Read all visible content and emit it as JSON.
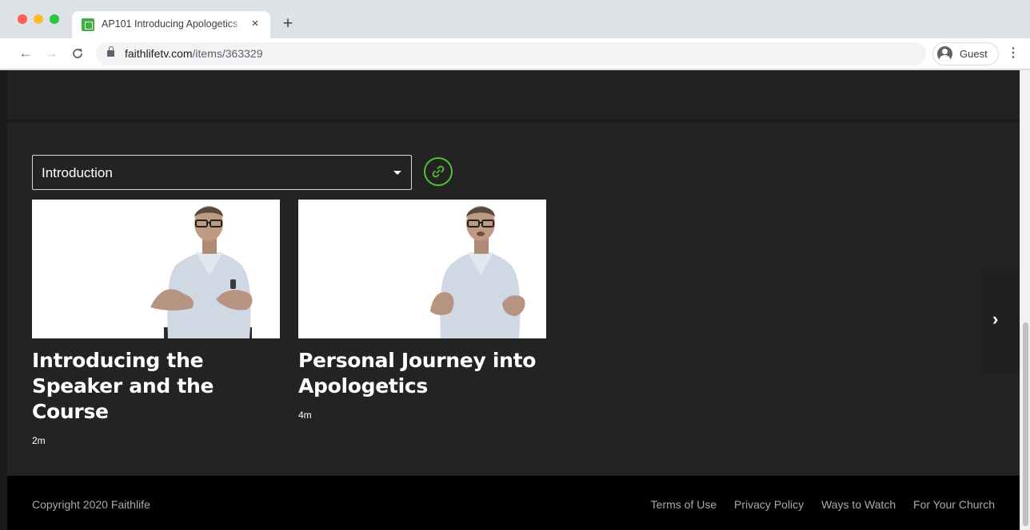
{
  "browser": {
    "tab_title": "AP101 Introducing Apologetics",
    "tab_close": "×",
    "new_tab": "+",
    "url_host": "faithlifetv.com",
    "url_path": "/items/363329",
    "profile_label": "Guest",
    "back_icon": "←",
    "forward_icon": "→",
    "reload_icon": "C",
    "menu_icon": "⋮"
  },
  "page": {
    "section_select": {
      "value": "Introduction"
    },
    "next_arrow": "›",
    "episodes": [
      {
        "title": "Introducing the Speaker and the Course",
        "duration": "2m"
      },
      {
        "title": "Personal Journey into Apologetics",
        "duration": "4m"
      }
    ]
  },
  "footer": {
    "copyright": "Copyright 2020 Faithlife",
    "links": [
      "Terms of Use",
      "Privacy Policy",
      "Ways to Watch",
      "For Your Church"
    ]
  },
  "colors": {
    "accent": "#4ec138",
    "page_bg": "#232323",
    "footer_bg": "#000000"
  }
}
